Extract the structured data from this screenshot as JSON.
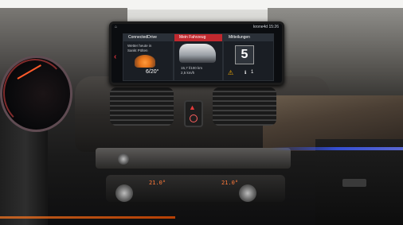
{
  "screen": {
    "status_left_icon": "home-icon",
    "status_right": "krone4d 15:26",
    "nav_left_icon": "chevron-left-icon",
    "tiles": [
      {
        "title": "ConnectedDrive",
        "weather_line1": "Wetter heute in",
        "weather_line2": "Sankt Pölten",
        "weather_icon": "storm-cloud-icon",
        "temperature": "6/20°"
      },
      {
        "title": "Mein Fahrzeug",
        "range": "15,7 l/100 km",
        "odometer": "2,5 km/h",
        "image": "car-icon"
      },
      {
        "title": "Mitteilungen",
        "calendar_day": "5",
        "warning_icon": "warning-triangle-icon",
        "info_icon": "info-icon",
        "info_count": "1"
      }
    ]
  },
  "climate": {
    "left_temp": "21.0°",
    "right_temp": "21.0°"
  }
}
